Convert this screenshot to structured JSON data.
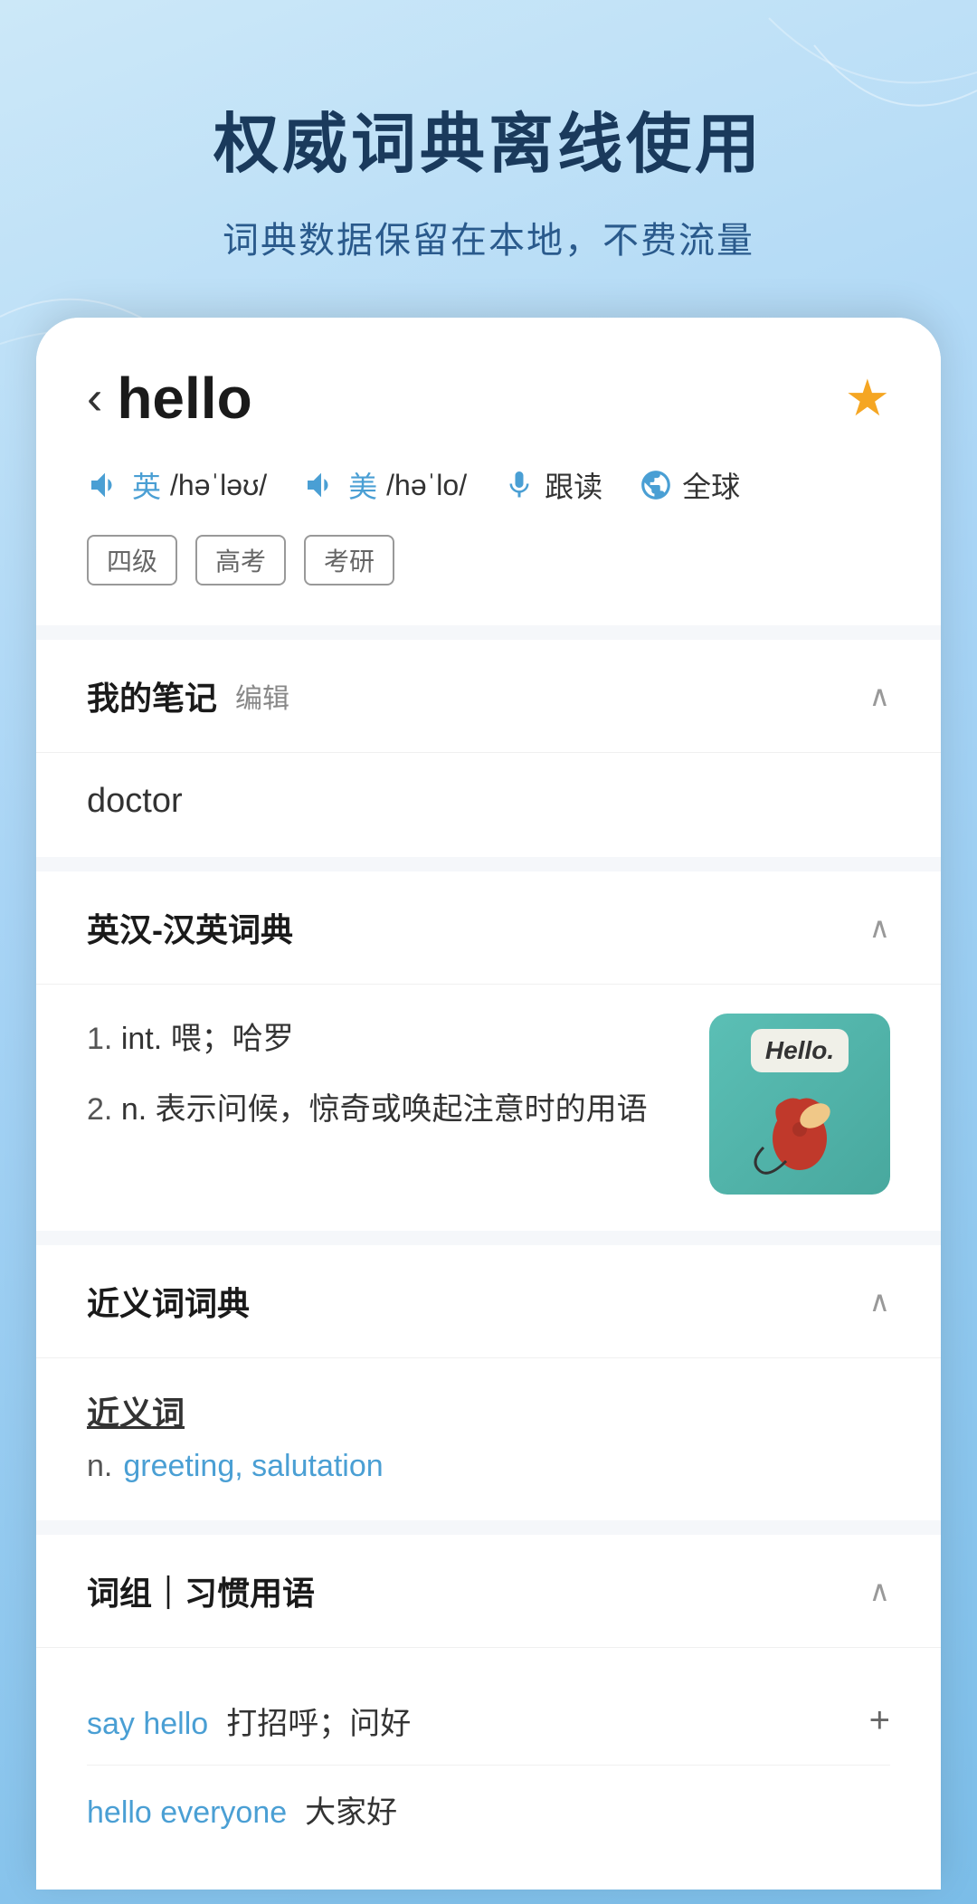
{
  "hero": {
    "title": "权威词典离线使用",
    "subtitle": "词典数据保留在本地，不费流量"
  },
  "card": {
    "word": "hello",
    "back_arrow": "‹",
    "star": "★",
    "phonetics": {
      "british_label": "英",
      "british_ipa": "/həˈləʊ/",
      "american_label": "美",
      "american_ipa": "/həˈlo/",
      "read_along": "跟读",
      "global": "全球"
    },
    "tags": [
      "四级",
      "高考",
      "考研"
    ],
    "sections": {
      "notes": {
        "title": "我的笔记",
        "edit_label": "编辑",
        "content": "doctor"
      },
      "dictionary": {
        "title": "英汉-汉英词典",
        "entries": [
          {
            "num": "1.",
            "pos": "int.",
            "text": "喂；哈罗"
          },
          {
            "num": "2.",
            "pos": "n.",
            "text": "表示问候，惊奇或唤起注意时的用语"
          }
        ]
      },
      "synonyms": {
        "title": "近义词词典",
        "syn_title": "近义词",
        "pos": "n.",
        "words": "greeting, salutation"
      },
      "phrases": {
        "title": "词组｜习惯用语",
        "items": [
          {
            "word": "say hello",
            "meaning": "打招呼；问好",
            "has_plus": true
          },
          {
            "word": "hello everyone",
            "meaning": "大家好",
            "has_plus": false
          }
        ]
      }
    }
  }
}
